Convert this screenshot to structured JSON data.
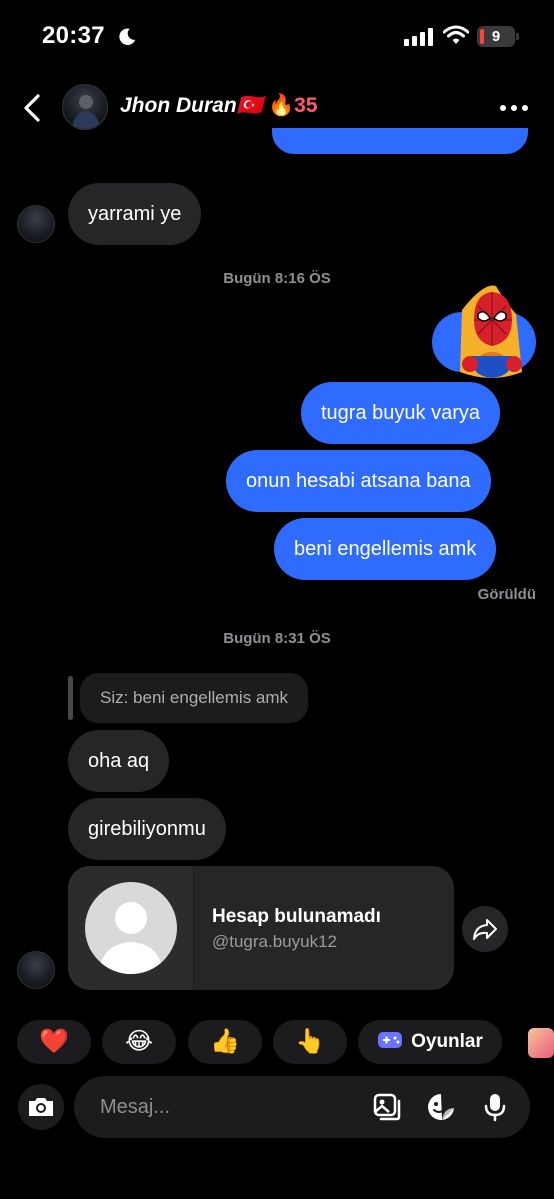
{
  "status_bar": {
    "time": "20:37",
    "battery": "9",
    "battery_level": 0.09
  },
  "header": {
    "name": "Jhon Duran🇹🇷",
    "streak": "🔥35"
  },
  "messages": {
    "m1": "yarrami ye",
    "ts1": "Bugün 8:16 ÖS",
    "m2": "tugra buyuk varya",
    "m3": "onun hesabi atsana bana",
    "m4": "beni engellemis amk",
    "seen": "Görüldü",
    "ts2": "Bugün 8:31 ÖS",
    "reply_quote": "Siz: beni engellemis amk",
    "m5": "oha aq",
    "m6": "girebiliyonmu"
  },
  "profile_card": {
    "title": "Hesap bulunamadı",
    "handle": "@tugra.buyuk12"
  },
  "quick_replies": {
    "heart": "❤️",
    "laugh": "😂",
    "thumbs": "👍",
    "point": "👆",
    "games": "Oyunlar"
  },
  "composer": {
    "placeholder": "Mesaj..."
  },
  "colors": {
    "outgoing": "#2f6bff",
    "incoming": "#262628",
    "streak": "#ff5a6b"
  }
}
